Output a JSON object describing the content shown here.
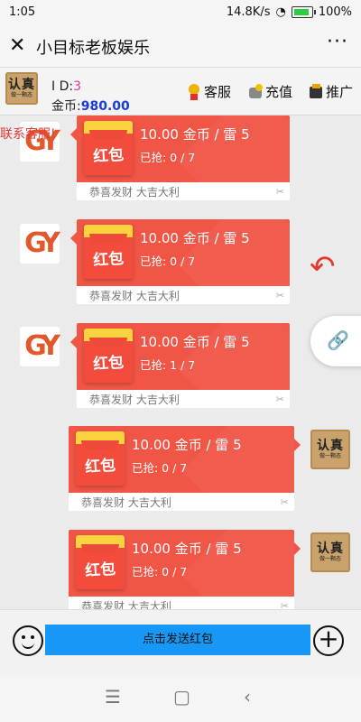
{
  "status": {
    "time": "1:05",
    "speed": "14.8K/s",
    "battery": "100%"
  },
  "titlebar": {
    "title": "小目标老板娱乐"
  },
  "info": {
    "avatar_big": "认真",
    "avatar_small": "做一颗态",
    "id_label": "I D:",
    "id_value": "3",
    "coin_label": "金币:",
    "coin_value": "980.00",
    "service": "客服",
    "recharge": "充值",
    "promote": "推广"
  },
  "marquee": "联系客服!",
  "packets": [
    {
      "amount": "10.00 金币 / 雷 5",
      "grabbed": "已抢: 0 / 7",
      "wish": "恭喜发财 大吉大利",
      "env": "红包"
    },
    {
      "amount": "10.00 金币 / 雷 5",
      "grabbed": "已抢: 0 / 7",
      "wish": "恭喜发财 大吉大利",
      "env": "红包"
    },
    {
      "amount": "10.00 金币 / 雷 5",
      "grabbed": "已抢: 1 / 7",
      "wish": "恭喜发财 大吉大利",
      "env": "红包"
    },
    {
      "amount": "10.00 金币 / 雷 5",
      "grabbed": "已抢: 0 / 7",
      "wish": "恭喜发财 大吉大利",
      "env": "红包"
    },
    {
      "amount": "10.00 金币 / 雷 5",
      "grabbed": "已抢: 0 / 7",
      "wish": "恭喜发财 大吉大利",
      "env": "红包"
    }
  ],
  "input": {
    "send_label": "点击发送红包"
  },
  "colors": {
    "packet_red": "#f05545",
    "send_blue": "#1797f6",
    "coin_blue": "#1a3bd4",
    "id_pink": "#e5389b"
  }
}
